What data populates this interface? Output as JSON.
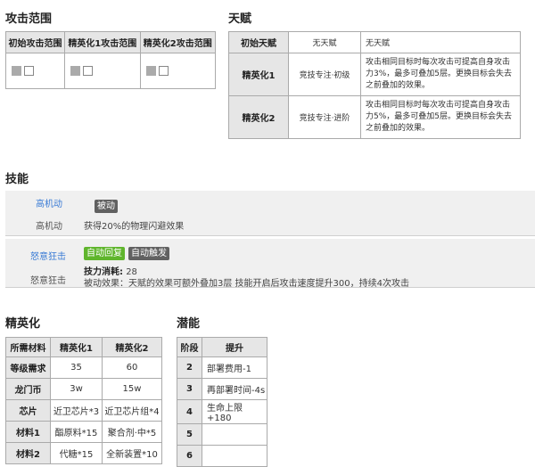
{
  "attack_range": {
    "title": "攻击范围",
    "headers": [
      "初始攻击范围",
      "精英化1攻击范围",
      "精英化2攻击范围"
    ]
  },
  "talent": {
    "title": "天赋",
    "header": [
      "初始天赋",
      "无天赋",
      "无天赋"
    ],
    "rows": [
      {
        "stage": "精英化1",
        "name": "竞技专注·初级",
        "desc": "攻击相同目标时每次攻击可提高自身攻击力3%，最多可叠加5层。更换目标会失去之前叠加的效果。"
      },
      {
        "stage": "精英化2",
        "name": "竞技专注·进阶",
        "desc": "攻击相同目标时每次攻击可提高自身攻击力5%，最多可叠加5层。更换目标会失去之前叠加的效果。"
      }
    ]
  },
  "skills": {
    "title": "技能",
    "items": [
      {
        "name": "高机动",
        "sub": "高机动",
        "tags": [
          "被动"
        ],
        "desc": "获得20%的物理闪避效果"
      },
      {
        "name": "怒意狂击",
        "sub": "怒意狂击",
        "tags": [
          "自动回复",
          "自动触发"
        ],
        "sp_label": "技力消耗:",
        "sp_value": "28",
        "desc": "被动效果：天赋的效果可额外叠加3层 技能开启后攻击速度提升300，持续4次攻击"
      }
    ]
  },
  "elite": {
    "title": "精英化",
    "headers": [
      "所需材料",
      "精英化1",
      "精英化2"
    ],
    "rows": [
      [
        "等级需求",
        "35",
        "60"
      ],
      [
        "龙门币",
        "3w",
        "15w"
      ],
      [
        "芯片",
        "近卫芯片*3",
        "近卫芯片组*4"
      ],
      [
        "材料1",
        "酯原料*15",
        "聚合剂·中*5"
      ],
      [
        "材料2",
        "代糖*15",
        "全新装置*10"
      ]
    ]
  },
  "potential": {
    "title": "潜能",
    "headers": [
      "阶段",
      "提升"
    ],
    "rows": [
      [
        "2",
        "部署费用-1"
      ],
      [
        "3",
        "再部署时间-4s"
      ],
      [
        "4",
        "生命上限+180"
      ],
      [
        "5",
        ""
      ],
      [
        "6",
        ""
      ]
    ]
  }
}
